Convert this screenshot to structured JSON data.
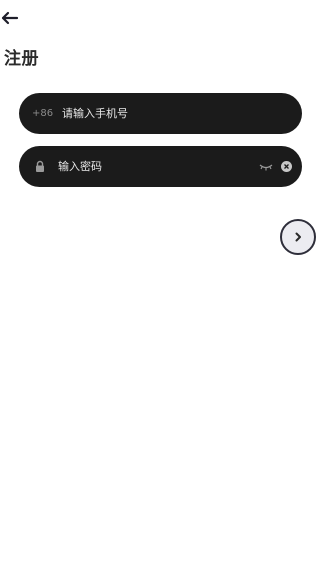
{
  "header": {
    "back_icon": "arrow-left-icon",
    "title": "注册"
  },
  "form": {
    "phone": {
      "country_code": "+86",
      "placeholder": "请输入手机号",
      "value": ""
    },
    "password": {
      "lock_icon": "lock-icon",
      "placeholder": "输入密码",
      "value": "",
      "visibility_icon": "eye-closed-icon",
      "clear_icon": "clear-icon"
    },
    "next_icon": "chevron-right-icon"
  },
  "colors": {
    "field_background": "#1b1b1b",
    "next_button_background": "#ececf1",
    "next_button_border": "#2e2e3a"
  }
}
